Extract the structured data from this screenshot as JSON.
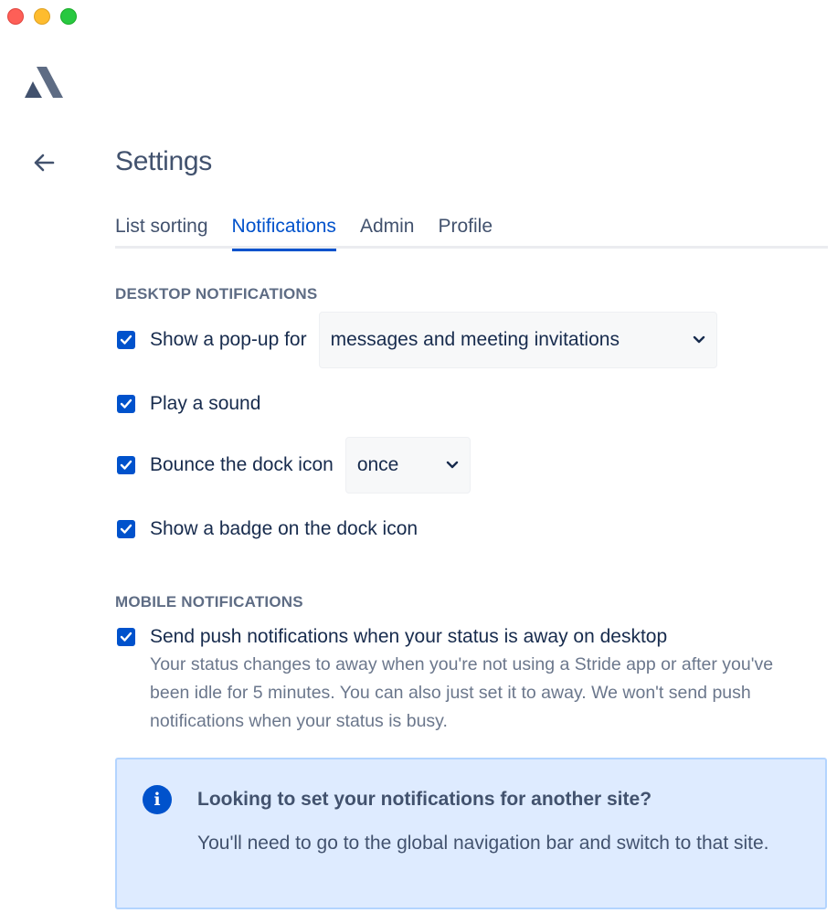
{
  "window": {
    "controls": [
      "close",
      "minimize",
      "zoom"
    ]
  },
  "app": {
    "logo_icon": "atlassian-stride-logo",
    "back_icon": "arrow-left-icon"
  },
  "page": {
    "title": "Settings"
  },
  "tabs": [
    {
      "label": "List sorting",
      "active": false
    },
    {
      "label": "Notifications",
      "active": true
    },
    {
      "label": "Admin",
      "active": false
    },
    {
      "label": "Profile",
      "active": false
    }
  ],
  "desktop": {
    "section_title": "DESKTOP NOTIFICATIONS",
    "popup": {
      "label": "Show a pop-up for",
      "checked": true,
      "select_value": "messages and meeting invitations"
    },
    "sound": {
      "label": "Play a sound",
      "checked": true
    },
    "bounce": {
      "label": "Bounce the dock icon",
      "checked": true,
      "select_value": "once"
    },
    "badge": {
      "label": "Show a badge on the dock icon",
      "checked": true
    }
  },
  "mobile": {
    "section_title": "MOBILE NOTIFICATIONS",
    "push": {
      "label": "Send push notifications when your status is away on desktop",
      "checked": true,
      "description": "Your status changes to away when you're not using a Stride app or after you've been idle for 5 minutes. You can also just set it to away. We won't send push notifications when your status is busy."
    }
  },
  "info": {
    "icon": "info-icon",
    "glyph": "i",
    "title": "Looking to set your notifications for another site?",
    "body": "You'll need to go to the global navigation bar and switch to that site."
  },
  "colors": {
    "accent": "#0052CC",
    "info_bg": "#DEEBFF",
    "text": "#172B4D",
    "subtle": "#6B778C"
  }
}
